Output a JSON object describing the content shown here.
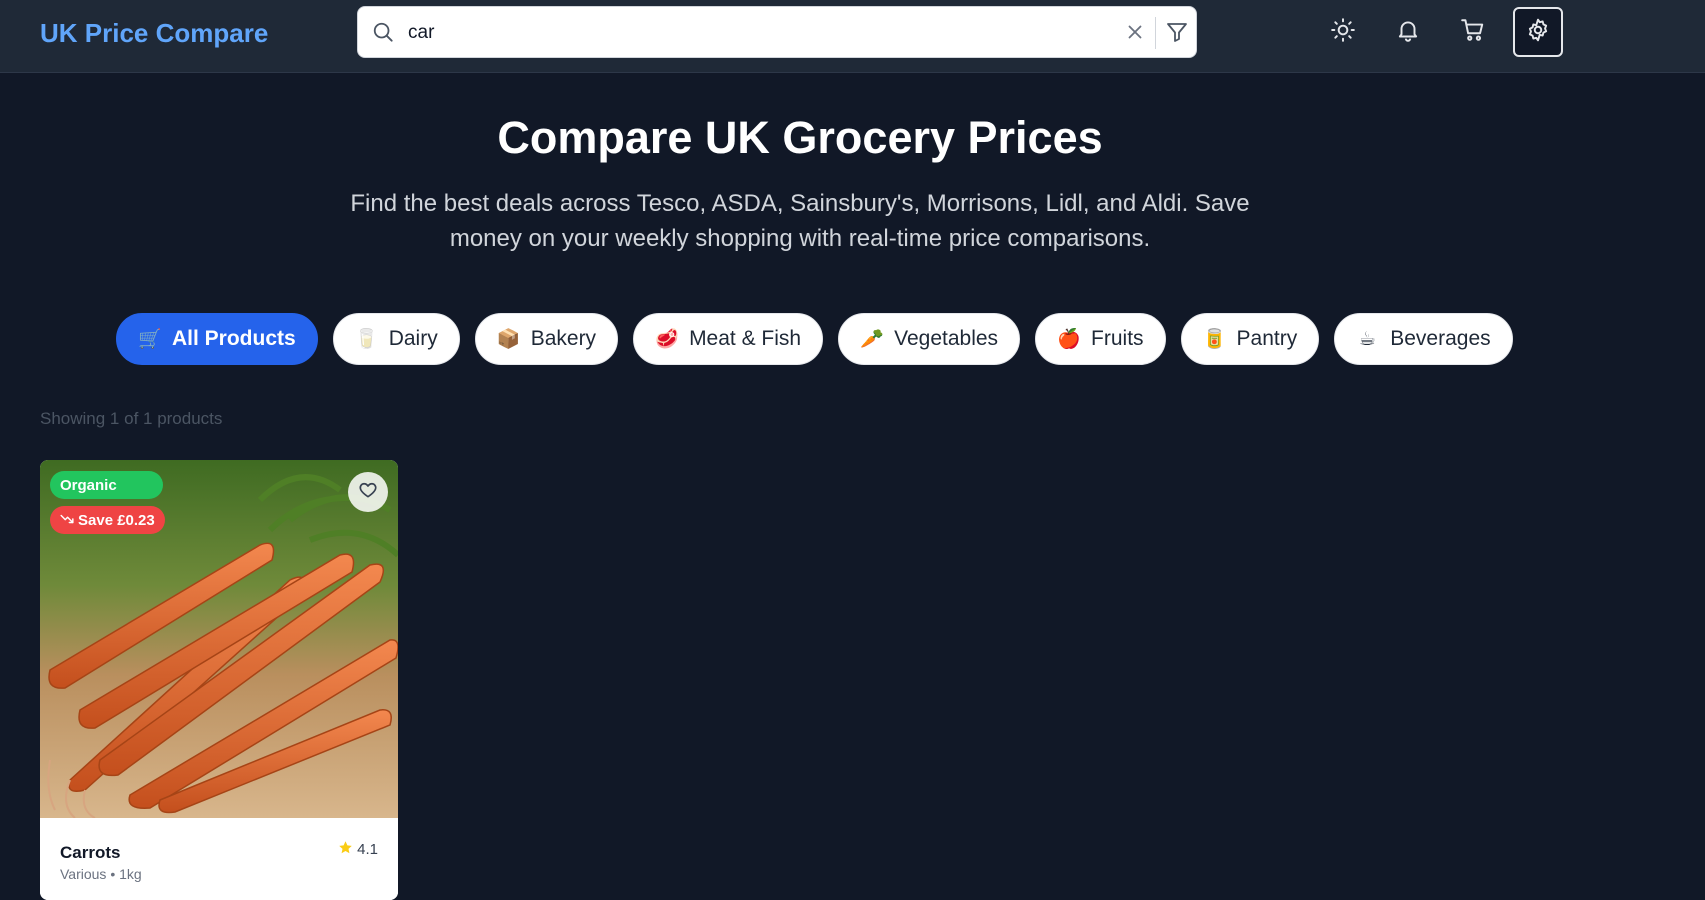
{
  "header": {
    "logo": "UK Price Compare",
    "search": {
      "value": "car",
      "placeholder": ""
    },
    "icons": [
      "search-icon",
      "close-icon",
      "filter-icon",
      "sun-icon",
      "bell-icon",
      "cart-icon",
      "gear-icon"
    ]
  },
  "hero": {
    "title": "Compare UK Grocery Prices",
    "subtitle": "Find the best deals across Tesco, ASDA, Sainsbury's, Morrisons, Lidl, and Aldi. Save money on your weekly shopping with real-time price comparisons."
  },
  "categories": [
    {
      "label": "All Products",
      "emoji": "🛒",
      "active": true
    },
    {
      "label": "Dairy",
      "emoji": "🥛",
      "active": false
    },
    {
      "label": "Bakery",
      "emoji": "📦",
      "active": false
    },
    {
      "label": "Meat & Fish",
      "emoji": "🥩",
      "active": false
    },
    {
      "label": "Vegetables",
      "emoji": "🥕",
      "active": false
    },
    {
      "label": "Fruits",
      "emoji": "🍎",
      "active": false
    },
    {
      "label": "Pantry",
      "emoji": "🥫",
      "active": false
    },
    {
      "label": "Beverages",
      "emoji": "☕",
      "active": false
    }
  ],
  "results": {
    "count_text": "Showing 1 of 1 products"
  },
  "products": [
    {
      "name": "Carrots",
      "meta": "Various • 1kg",
      "rating": "4.1",
      "badge_organic": "Organic",
      "badge_save": "Save £0.23"
    }
  ],
  "colors": {
    "background": "#111827",
    "header": "#1f2937",
    "accent": "#2563eb",
    "logo": "#60a5fa",
    "organic": "#22c55e",
    "save": "#ef4444"
  }
}
